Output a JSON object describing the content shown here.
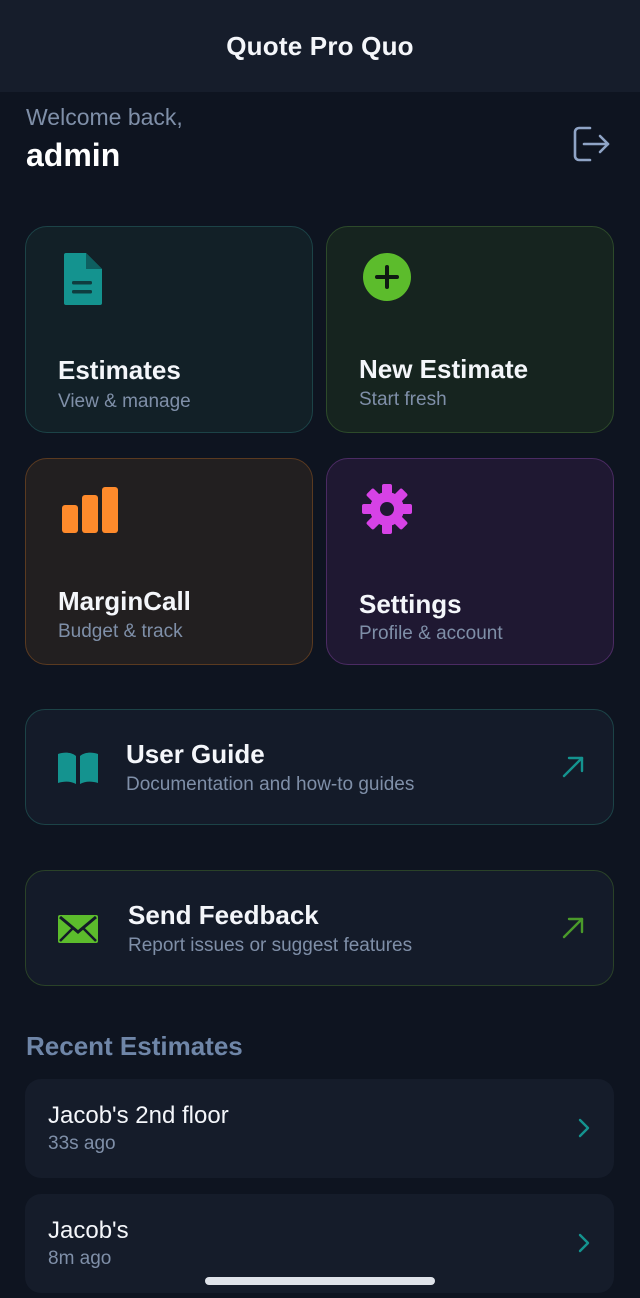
{
  "header": {
    "title": "Quote Pro Quo"
  },
  "welcome": {
    "greeting": "Welcome back,",
    "username": "admin"
  },
  "icons": {
    "logout": "logout-icon",
    "estimates": "document-icon",
    "new_estimate": "plus-circle-icon",
    "margincall": "bar-chart-icon",
    "settings": "gear-icon",
    "guide": "book-icon",
    "feedback": "envelope-icon",
    "external": "external-arrow-icon",
    "chevron": "chevron-right-icon"
  },
  "tiles": [
    {
      "title": "Estimates",
      "subtitle": "View & manage",
      "accent": "#14938f"
    },
    {
      "title": "New Estimate",
      "subtitle": "Start fresh",
      "accent": "#5cbc2c"
    },
    {
      "title": "MarginCall",
      "subtitle": "Budget & track",
      "accent": "#ff8a2b"
    },
    {
      "title": "Settings",
      "subtitle": "Profile & account",
      "accent": "#d642e6"
    }
  ],
  "links": [
    {
      "title": "User Guide",
      "subtitle": "Documentation and how-to guides"
    },
    {
      "title": "Send Feedback",
      "subtitle": "Report issues or suggest features"
    }
  ],
  "recent": {
    "title": "Recent Estimates",
    "items": [
      {
        "name": "Jacob's 2nd floor",
        "time": "33s ago"
      },
      {
        "name": "Jacob's",
        "time": "8m ago"
      }
    ]
  }
}
